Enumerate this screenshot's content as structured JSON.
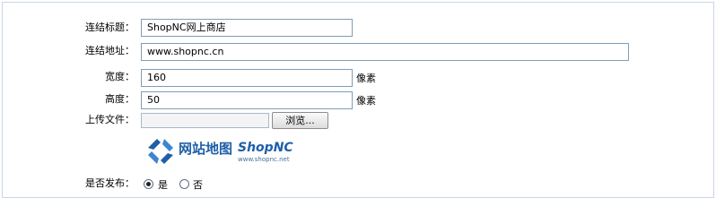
{
  "form": {
    "link_title": {
      "label": "连结标题：",
      "value": "ShopNC网上商店"
    },
    "link_url": {
      "label": "连结地址：",
      "value": "www.shopnc.cn"
    },
    "width": {
      "label": "宽度：",
      "value": "160",
      "unit": "像素"
    },
    "height": {
      "label": "高度：",
      "value": "50",
      "unit": "像素"
    },
    "upload": {
      "label": "上传文件：",
      "button": "浏览..."
    },
    "logo": {
      "text_cn": "网站地图",
      "text_en": "ShopNC",
      "url": "www.shopnc.net"
    },
    "publish": {
      "label": "是否发布：",
      "yes": "是",
      "no": "否",
      "selected": "yes"
    }
  },
  "colors": {
    "frame_border": "#c9d6e6",
    "input_border": "#7f9db9",
    "logo_blue": "#1f5fa8"
  }
}
